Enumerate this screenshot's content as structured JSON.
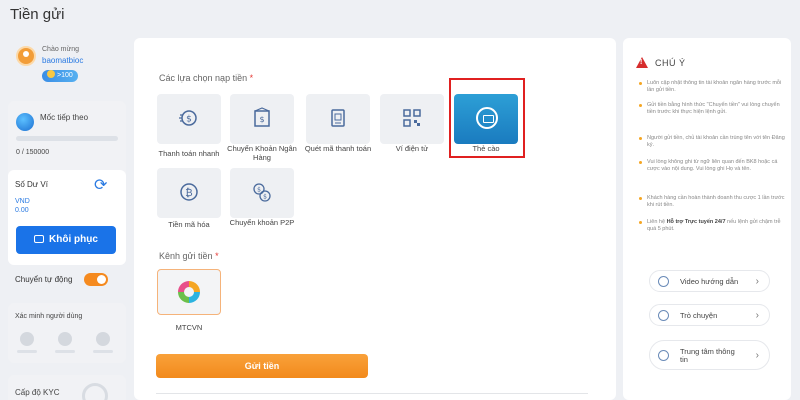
{
  "page_title": "Tiền gửi",
  "user": {
    "greeting": "Chào mừng",
    "username": "baomatbioc",
    "vip_label": ">100"
  },
  "level": {
    "label": "Mốc tiếp theo",
    "progress_text": "0 / 150000",
    "progress_fraction": 0
  },
  "balance": {
    "label": "Số Dư Ví",
    "currency": "VND",
    "amount": "0.00",
    "restore_label": "Khôi phục"
  },
  "auto_transfer": {
    "label": "Chuyển tự động",
    "enabled": true
  },
  "verification": {
    "label": "Xác minh người dùng"
  },
  "kyc": {
    "label": "Cấp độ KYC"
  },
  "deposit_options": {
    "label": "Các lựa chọn nạp tiền",
    "required_mark": "*",
    "items": [
      {
        "label": "Thanh toán nhanh",
        "icon": "fast-payment-icon"
      },
      {
        "label": "Chuyển Khoản Ngân Hàng",
        "icon": "bank-transfer-icon"
      },
      {
        "label": "Quét mã thanh toán",
        "icon": "scan-code-icon"
      },
      {
        "label": "Ví điện tử",
        "icon": "qr-wallet-icon"
      },
      {
        "label": "Thẻ cào",
        "icon": "scratch-card-icon",
        "selected": true
      },
      {
        "label": "Tiền mã hóa",
        "icon": "crypto-icon"
      },
      {
        "label": "Chuyển khoản P2P",
        "icon": "p2p-transfer-icon"
      }
    ]
  },
  "channel": {
    "label": "Kênh gửi tiền",
    "required_mark": "*",
    "items": [
      {
        "label": "MTCVN",
        "icon": "mtcvn-logo"
      }
    ]
  },
  "submit_label": "Gửi tiền",
  "notes": {
    "title": "CHÚ Ý",
    "items": [
      "Luôn cập nhật thông tin tài khoản ngân hàng trước mỗi lần gửi tiền.",
      "Gửi tiền bằng hình thức \"Chuyển tiền\" vui lòng chuyển tiền trước khi thực hiện lệnh gửi.",
      "Người gửi tiền, chủ tài khoản cần trùng tên với tên Đăng ký.",
      "Vui lòng không ghi từ ngữ liên quan đến BK8 hoặc cá cược vào nội dung. Vui lòng ghi Họ và tên.",
      "Khách hàng cần hoàn thành doanh thu cược 1 lần trước khi rút tiền."
    ],
    "support_prefix": "Liên hệ ",
    "support_bold": "Hỗ trợ Trực tuyến 24/7",
    "support_suffix": " nếu lệnh gửi chậm trễ quá 5 phút."
  },
  "links": [
    {
      "label": "Video hướng dẫn",
      "icon": "video-icon"
    },
    {
      "label": "Trò chuyện",
      "icon": "chat-icon"
    },
    {
      "label": "Trung tâm thông tin",
      "icon": "info-center-icon"
    }
  ],
  "colors": {
    "primary": "#1a73e8",
    "accent": "#f28a1c",
    "selected_tile": "#1a7bbf",
    "warning": "#d62d2d"
  }
}
